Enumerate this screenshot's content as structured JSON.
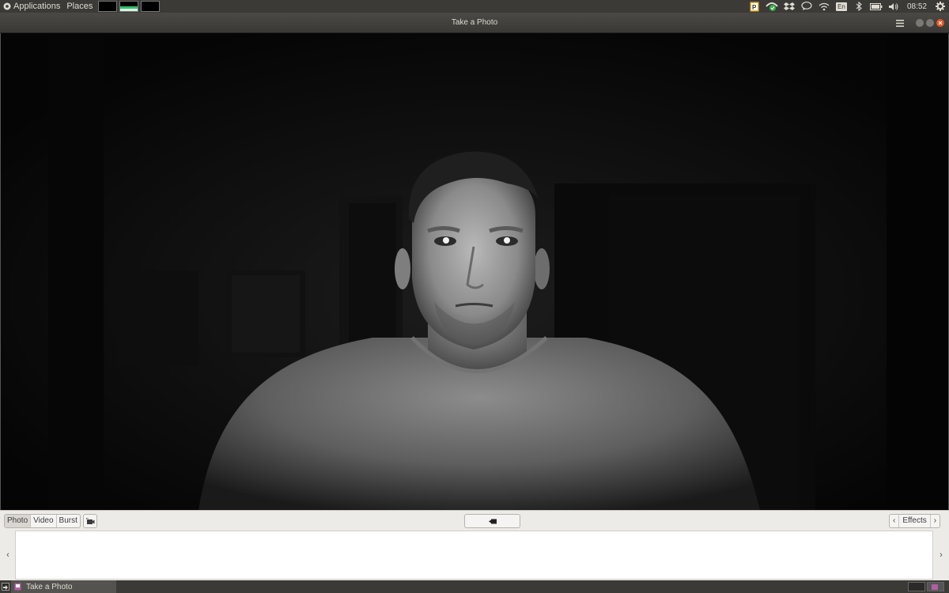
{
  "top_panel": {
    "applications_label": "Applications",
    "places_label": "Places",
    "clock": "08:52",
    "keyboard_layout": "En",
    "icons": [
      "applications-icon",
      "parking-indicator-icon",
      "update-shield-icon",
      "dropbox-icon",
      "chat-icon",
      "wifi-icon",
      "keyboard-icon",
      "bluetooth-icon",
      "battery-icon",
      "volume-icon",
      "system-gear-icon"
    ]
  },
  "window": {
    "title": "Take a Photo",
    "menu_icon": "hamburger-menu-icon",
    "controls": [
      "minimize-button",
      "maximize-button",
      "close-button"
    ]
  },
  "toolbar": {
    "modes": [
      "Photo",
      "Video",
      "Burst"
    ],
    "active_mode": "Photo",
    "fullscreen_icon": "camera-fullscreen-icon",
    "capture_icon": "take-photo-icon",
    "effects_label": "Effects",
    "prev_icon": "chevron-left-icon",
    "next_icon": "chevron-right-icon"
  },
  "strip": {
    "left_icon": "chevron-left-icon",
    "right_icon": "chevron-right-icon"
  },
  "bottom_panel": {
    "task_label": "Take a Photo",
    "show_desktop_icon": "show-desktop-icon"
  },
  "colors": {
    "panel": "#3b3a37",
    "titlebar": "#3a3936",
    "close": "#e9541f",
    "toolbar": "#edebe8"
  }
}
